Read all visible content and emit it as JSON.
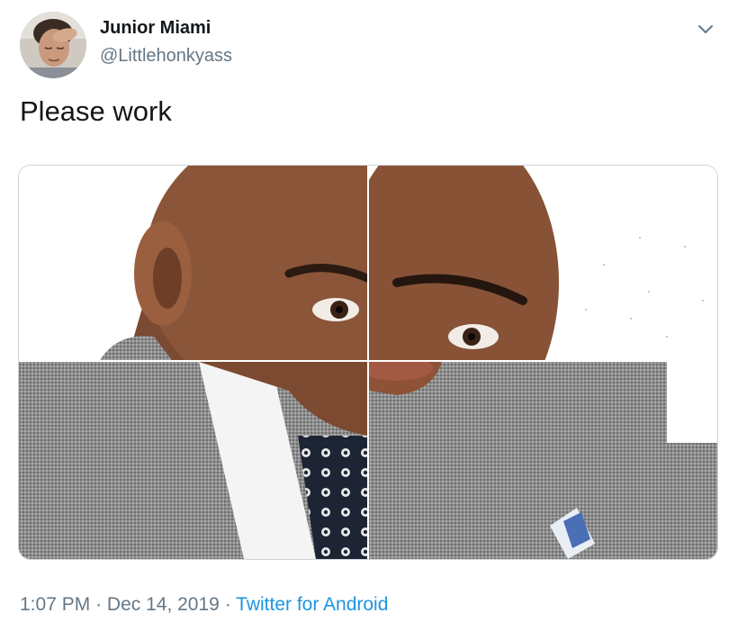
{
  "user": {
    "name": "Junior Miami",
    "handle": "@Littlehonkyass",
    "avatar_icon": "profile-photo-icon"
  },
  "tweet": {
    "text": "Please work",
    "media_icon": "photo-grid-icon"
  },
  "meta": {
    "time": "1:07 PM",
    "separator1": "·",
    "date": "Dec 14, 2019",
    "separator2": "·",
    "source": "Twitter for Android"
  },
  "colors": {
    "text_primary": "#14171a",
    "text_secondary": "#657786",
    "link": "#1b95e0",
    "border": "#ccd6dd"
  },
  "icons": {
    "menu": "chevron-down-icon"
  }
}
